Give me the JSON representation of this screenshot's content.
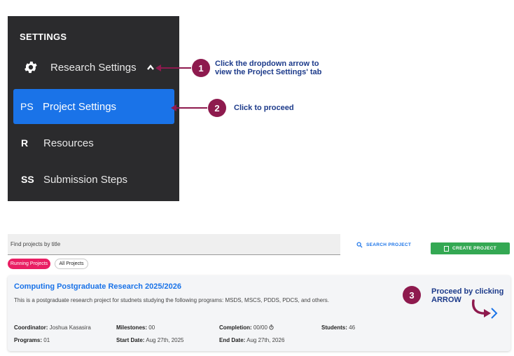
{
  "sidebar": {
    "title": "SETTINGS",
    "research": {
      "label": "Research Settings",
      "icon": "gear-icon"
    },
    "active_item": {
      "abbr": "PS",
      "label": "Project Settings"
    },
    "items": [
      {
        "abbr": "R",
        "label": "Resources"
      },
      {
        "abbr": "SS",
        "label": "Submission Steps"
      }
    ],
    "active_color": "#1a73e8",
    "background": "#2b2b2d"
  },
  "callouts": [
    {
      "number": "1",
      "line1": "Click the dropdown arrow to",
      "line2": "view the Project Settings' tab"
    },
    {
      "number": "2",
      "line1": "Click to proceed"
    },
    {
      "number": "3",
      "line1": "Proceed by clicking",
      "line2": "ARROW"
    }
  ],
  "search": {
    "placeholder": "Find projects by title",
    "search_label": "SEARCH PROJECT",
    "create_label": "CREATE PROJECT"
  },
  "filters": [
    {
      "label": "Running Projects",
      "active": true
    },
    {
      "label": "All Projects",
      "active": false
    }
  ],
  "project": {
    "title": "Computing Postgraduate Research 2025/2026",
    "description": "This is a postgraduate research project for studnets studying the following programs: MSDS, MSCS, PDDS, PDCS, and others.",
    "coordinator_label": "Coordinator:",
    "coordinator": "Joshua Kasasira",
    "milestones_label": "Milestones:",
    "milestones": "00",
    "completion_label": "Completion:",
    "completion": "00/00",
    "students_label": "Students:",
    "students": "46",
    "programs_label": "Programs:",
    "programs": "01",
    "start_label": "Start Date:",
    "start_date": "Aug 27th, 2025",
    "end_label": "End Date:",
    "end_date": "Aug 27th, 2026"
  },
  "colors": {
    "accent": "#1a73e8",
    "callout": "#8e1a4e",
    "callout_text": "#1c3a8a",
    "create": "#34a853",
    "running_pill": "#e91e63"
  }
}
